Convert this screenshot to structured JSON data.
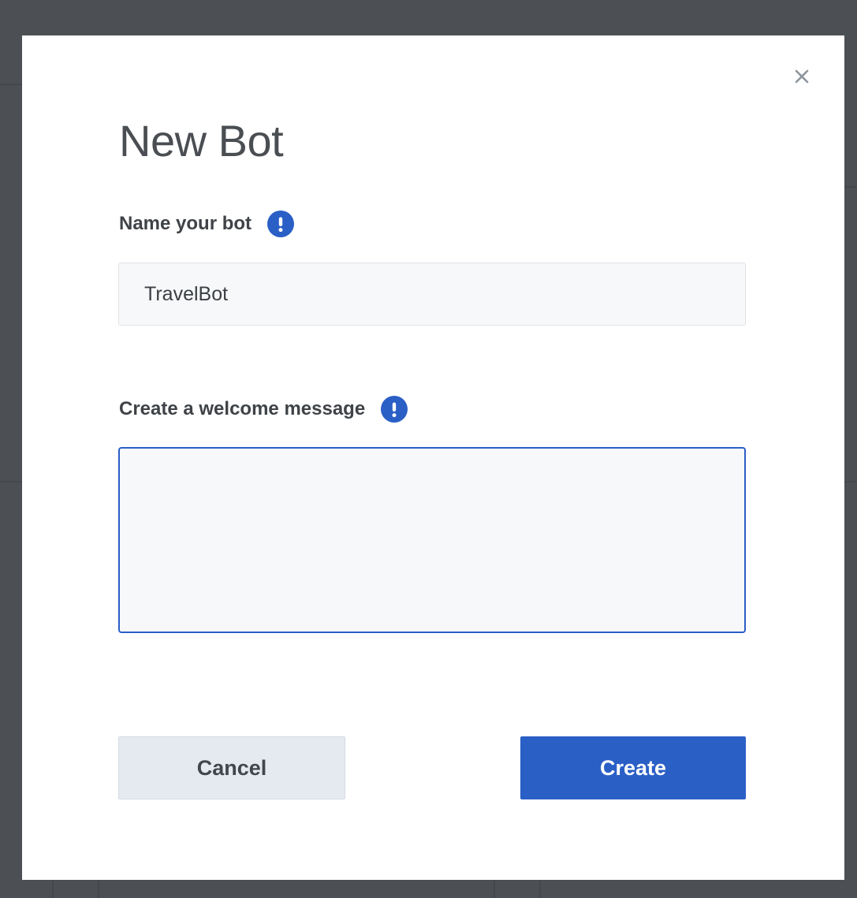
{
  "modal": {
    "title": "New Bot",
    "close_icon": "close-icon"
  },
  "name_field": {
    "label": "Name your bot",
    "info_icon": "info-exclamation-icon",
    "value": "TravelBot"
  },
  "welcome_field": {
    "label": "Create a welcome message",
    "info_icon": "info-exclamation-icon",
    "value": ""
  },
  "buttons": {
    "cancel_label": "Cancel",
    "create_label": "Create"
  },
  "colors": {
    "accent": "#2a5fc6",
    "overlay": "#4c5054"
  }
}
